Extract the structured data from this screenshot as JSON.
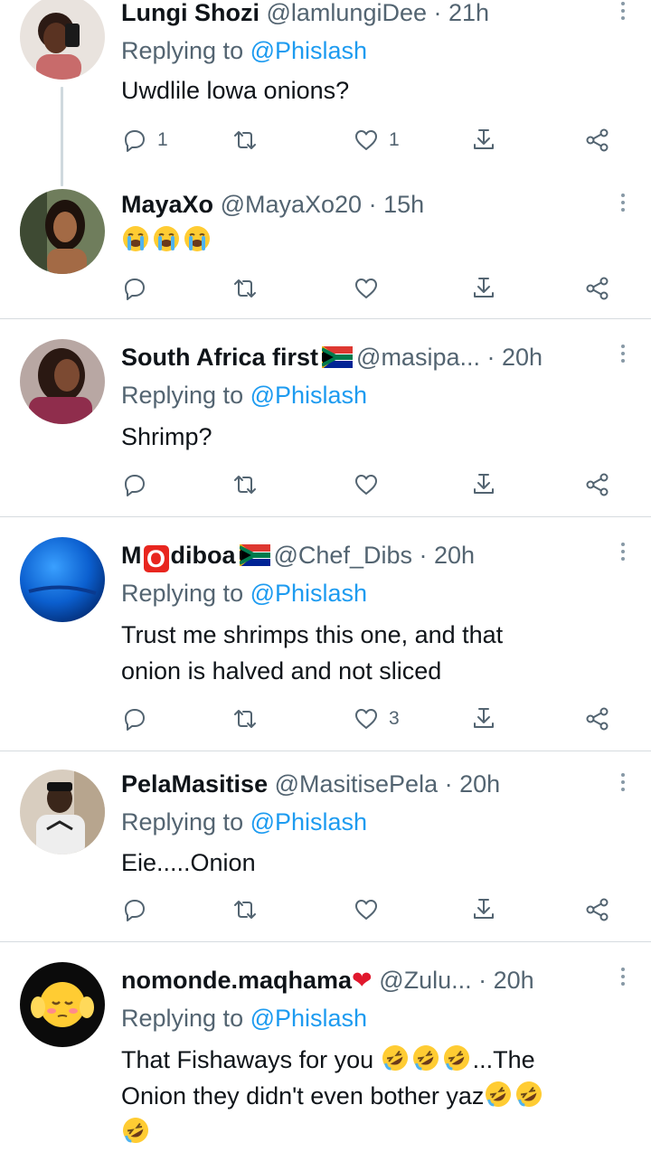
{
  "tweets": [
    {
      "name": "Lungi Shozi",
      "handle": "@lamlungiDee",
      "time": "21h",
      "replying_prefix": "Replying to ",
      "replying_to": "@Phislash",
      "text": "Uwdlile lowa onions?",
      "reply_count": "1",
      "like_count": "1"
    },
    {
      "name": "MayaXo",
      "handle": "@MayaXo20",
      "time": "15h",
      "text_emoji": [
        "loudly-crying-face",
        "loudly-crying-face",
        "loudly-crying-face"
      ]
    },
    {
      "name": "South Africa first",
      "flag": "south-africa-flag",
      "handle": "@masipa...",
      "time": "20h",
      "replying_prefix": "Replying to ",
      "replying_to": "@Phislash",
      "text": "Shrimp?"
    },
    {
      "name_prefix": "M",
      "name_boxed": "O",
      "name_suffix": "diboa",
      "flag": "south-africa-flag",
      "handle": "@Chef_Dibs",
      "time": "20h",
      "replying_prefix": "Replying to ",
      "replying_to": "@Phislash",
      "text_line1": "Trust me shrimps this one, and that",
      "text_line2": "onion is halved and not sliced",
      "like_count": "3"
    },
    {
      "name": "PelaMasitise",
      "handle": "@MasitisePela",
      "time": "20h",
      "replying_prefix": "Replying to ",
      "replying_to": "@Phislash",
      "text": "Eie.....Onion"
    },
    {
      "name": "nomonde.maqhama",
      "name_emoji": "red-heart",
      "handle": "@Zulu...",
      "time": "20h",
      "replying_prefix": "Replying to ",
      "replying_to": "@Phislash",
      "text_part1": "That Fishaways for you ",
      "text_part2": "...The",
      "text_line2": "Onion they didn't even bother yaz",
      "text_emoji": "rolling-on-the-floor-laughing"
    }
  ],
  "separator": " · ",
  "colors": {
    "link": "#1d9bf0",
    "muted": "#536471",
    "text": "#0f1419",
    "divider": "#d6dbdf"
  },
  "icons": [
    "reply-icon",
    "retweet-icon",
    "like-icon",
    "download-icon",
    "share-icon",
    "more-icon"
  ]
}
